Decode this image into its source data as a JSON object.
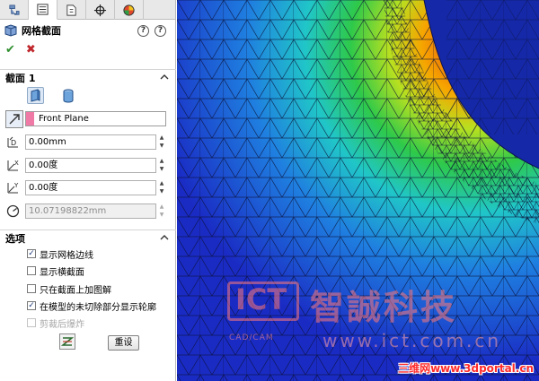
{
  "panel": {
    "title": "网格截面",
    "help_label": "?",
    "tips_label": "?",
    "ok_label": "✔",
    "cancel_label": "✖"
  },
  "section1": {
    "heading": "截面 1",
    "plane_value": "Front Plane",
    "offset_value": "0.00mm",
    "rotate_x_value": "0.00度",
    "rotate_y_value": "0.00度",
    "radius_value": "10.07198822mm"
  },
  "options": {
    "heading": "选项",
    "items": [
      {
        "label": "显示网格边线",
        "checked": true,
        "enabled": true
      },
      {
        "label": "显示横截面",
        "checked": false,
        "enabled": true
      },
      {
        "label": "只在截面上加图解",
        "checked": false,
        "enabled": true
      },
      {
        "label": "在模型的未切除部分显示轮廓",
        "checked": true,
        "enabled": true
      },
      {
        "label": "剪裁后爆炸",
        "checked": false,
        "enabled": false
      }
    ],
    "reset_label": "重设"
  },
  "watermark": {
    "logo_text": "ICT",
    "logo_subtext": "CAD/CAM",
    "company": "智誠科技",
    "url": "www.ict.com.cn",
    "site": "三维网www.3dportal.cn"
  },
  "colors": {
    "accent_blue": "#1a2bc4",
    "plane_swatch": "#f07aa6",
    "watermark_red": "#ff2a2a"
  }
}
